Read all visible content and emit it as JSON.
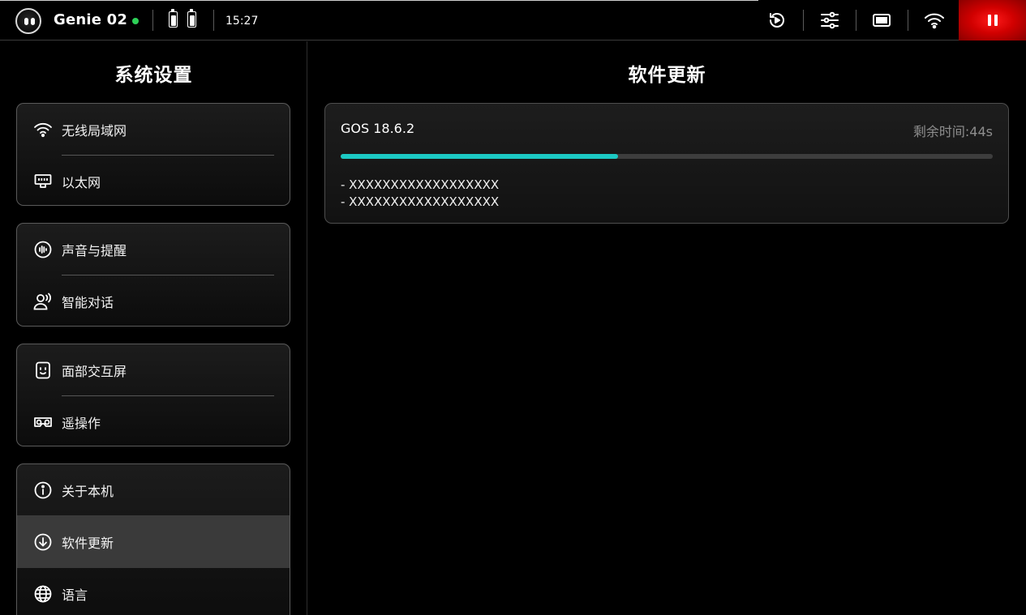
{
  "status_bar": {
    "robot_name": "Genie 02",
    "online_color": "#2ed158",
    "time": "15:27",
    "battery_icons": [
      "battery-icon",
      "battery-icon"
    ],
    "right_icons": [
      "replay-icon",
      "sliders-icon",
      "screen-icon",
      "wifi-icon"
    ],
    "pause_icon": "pause-icon",
    "pause_color": "#d10000"
  },
  "sidebar": {
    "title": "系统设置",
    "groups": [
      {
        "items": [
          {
            "label": "无线局域网",
            "icon": "wifi-icon"
          },
          {
            "label": "以太网",
            "icon": "ethernet-icon"
          }
        ]
      },
      {
        "items": [
          {
            "label": "声音与提醒",
            "icon": "sound-icon"
          },
          {
            "label": "智能对话",
            "icon": "voice-user-icon"
          }
        ]
      },
      {
        "items": [
          {
            "label": "面部交互屏",
            "icon": "face-screen-icon"
          },
          {
            "label": "遥操作",
            "icon": "vr-headset-icon"
          }
        ]
      },
      {
        "items": [
          {
            "label": "关于本机",
            "icon": "info-icon"
          },
          {
            "label": "软件更新",
            "icon": "download-icon",
            "active": true
          },
          {
            "label": "语言",
            "icon": "globe-icon"
          }
        ]
      }
    ]
  },
  "main": {
    "title": "软件更新",
    "update": {
      "version": "GOS 18.6.2",
      "remaining": "剩余时间:44s",
      "progress": 0.425,
      "progress_color": "#1cc9c3",
      "notes": [
        "- XXXXXXXXXXXXXXXXXX",
        "- XXXXXXXXXXXXXXXXXX"
      ]
    }
  }
}
